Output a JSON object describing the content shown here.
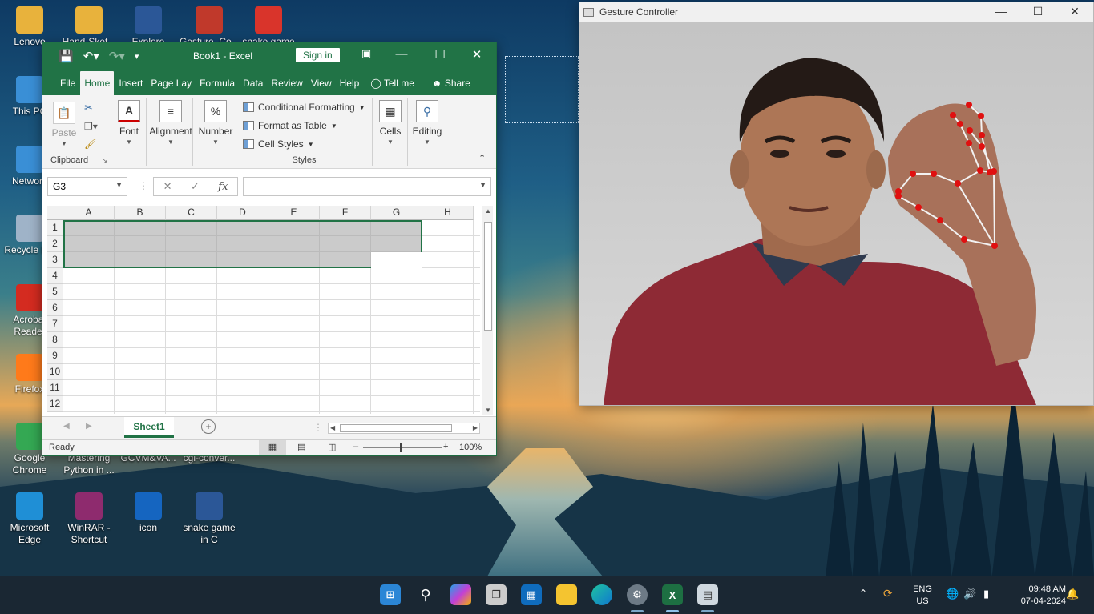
{
  "desktop": {
    "icons": [
      {
        "label": "Lenovo",
        "color": "#e8b23c"
      },
      {
        "label": "Hand-Sket...",
        "color": "#e8b23c"
      },
      {
        "label": "Explore",
        "color": "#2b5797"
      },
      {
        "label": "Gesture_Co...",
        "color": "#c0392b"
      },
      {
        "label": "snake game",
        "color": "#d9342b"
      },
      {
        "label": "This PC",
        "color": "#3a8fd6"
      },
      {
        "label": "Network",
        "color": "#3a8fd6"
      },
      {
        "label": "Recycle Bin",
        "color": "#9fb3c8"
      },
      {
        "label": "Acrobat Reader",
        "color": "#d42b20"
      },
      {
        "label": "Firefox",
        "color": "#ff7a1a"
      },
      {
        "label": "Google Chrome",
        "color": "#34a853"
      },
      {
        "label": "Mastering Python in ...",
        "color": "#444"
      },
      {
        "label": "GCVM&VA...",
        "color": "#444"
      },
      {
        "label": "cgi-conver...",
        "color": "#444"
      },
      {
        "label": "Microsoft Edge",
        "color": "#1f8fd6"
      },
      {
        "label": "WinRAR - Shortcut",
        "color": "#8e2b6e"
      },
      {
        "label": "icon",
        "color": "#1565c0"
      },
      {
        "label": "snake game in C",
        "color": "#2b5797"
      }
    ]
  },
  "excel": {
    "title": "Book1  -  Excel",
    "sign_in": "Sign in",
    "tabs": [
      "File",
      "Home",
      "Insert",
      "Page Lay",
      "Formula",
      "Data",
      "Review",
      "View",
      "Help"
    ],
    "tell_me": "Tell me",
    "share": "Share",
    "ribbon": {
      "paste": "Paste",
      "clipboard": "Clipboard",
      "font": "Font",
      "alignment": "Alignment",
      "number": "Number",
      "conditional_formatting": "Conditional Formatting",
      "format_as_table": "Format as Table",
      "cell_styles": "Cell Styles",
      "styles": "Styles",
      "cells": "Cells",
      "editing": "Editing"
    },
    "name_box": "G3",
    "fx": "fx",
    "columns": [
      "A",
      "B",
      "C",
      "D",
      "E",
      "F",
      "G",
      "H"
    ],
    "rows": [
      "1",
      "2",
      "3",
      "4",
      "5",
      "6",
      "7",
      "8",
      "9",
      "10",
      "11",
      "12"
    ],
    "sheet_tab": "Sheet1",
    "status": "Ready",
    "zoom": "100%"
  },
  "gesture": {
    "title": "Gesture Controller"
  },
  "taskbar": {
    "lang": "ENG",
    "region": "US",
    "time": "09:48 AM",
    "date": "07-04-2024"
  },
  "colors": {
    "excel_green": "#217346",
    "landmark_red": "#e01010"
  }
}
